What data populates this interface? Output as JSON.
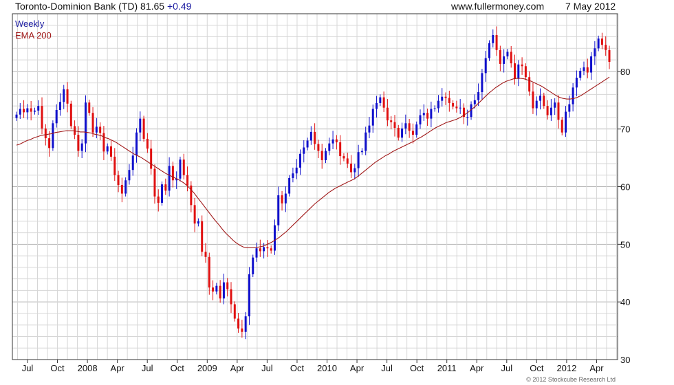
{
  "header": {
    "title": "Toronto-Dominion Bank (TD) 81.65",
    "change": "+0.49",
    "site": "www.fullermoney.com",
    "date": "7 May 2012"
  },
  "legend": {
    "weekly": "Weekly",
    "ema": "EMA 200"
  },
  "copyright": "© 2012 Stockcube Research Ltd",
  "colors": {
    "up": "#1010cc",
    "down": "#e01010",
    "ema": "#a01818",
    "grid": "#d6d6d6",
    "legend_weekly": "#1a1aa0",
    "legend_ema": "#a01818"
  },
  "chart_data": {
    "type": "candlestick",
    "ylim": [
      30,
      90
    ],
    "y_ticks": [
      "30",
      "40",
      "50",
      "60",
      "70",
      "80"
    ],
    "y_tick_values": [
      30,
      40,
      50,
      60,
      70,
      80
    ],
    "y_axis_side": "right",
    "x_ticks": [
      "Jul",
      "Oct",
      "2008",
      "Apr",
      "Jul",
      "Oct",
      "2009",
      "Apr",
      "Jul",
      "Oct",
      "2010",
      "Apr",
      "Jul",
      "Oct",
      "2011",
      "Apr",
      "Jul",
      "Oct",
      "2012",
      "Apr"
    ],
    "series": [
      {
        "name": "Weekly",
        "style": "candles",
        "values": [
          72.5,
          73.5,
          72.9,
          73.6,
          73.0,
          73.2,
          74.0,
          70.1,
          68.4,
          66.7,
          71.0,
          73.3,
          74.7,
          76.9,
          74.4,
          70.5,
          69.0,
          66.2,
          67.5,
          74.6,
          72.8,
          69.4,
          70.4,
          69.3,
          66.1,
          67.0,
          65.2,
          62.0,
          60.3,
          58.8,
          61.1,
          62.9,
          65.4,
          69.4,
          71.8,
          68.3,
          66.6,
          63.1,
          58.3,
          57.2,
          60.4,
          59.3,
          63.6,
          61.1,
          61.4,
          64.7,
          62.0,
          60.2,
          56.8,
          53.6,
          54.0,
          48.7,
          47.8,
          42.5,
          41.8,
          42.8,
          40.6,
          43.4,
          42.2,
          39.6,
          37.1,
          35.4,
          34.8,
          37.5,
          44.8,
          47.7,
          49.3,
          48.8,
          49.5,
          49.3,
          48.9,
          53.3,
          58.5,
          57.1,
          58.8,
          61.5,
          62.3,
          63.3,
          65.7,
          66.8,
          68.0,
          69.5,
          67.4,
          66.2,
          64.6,
          66.2,
          67.5,
          68.2,
          67.7,
          65.3,
          64.9,
          64.0,
          62.5,
          63.2,
          66.0,
          66.2,
          69.4,
          70.6,
          73.5,
          74.5,
          75.5,
          73.7,
          71.5,
          71.2,
          70.2,
          68.5,
          70.1,
          71.0,
          69.7,
          69.0,
          70.8,
          72.4,
          72.8,
          71.8,
          73.5,
          73.6,
          74.9,
          75.6,
          75.4,
          74.5,
          73.9,
          73.6,
          73.7,
          72.1,
          72.1,
          74.3,
          75.0,
          76.4,
          79.7,
          82.3,
          84.9,
          86.3,
          83.7,
          81.3,
          82.6,
          83.4,
          81.4,
          78.7,
          81.2,
          80.9,
          79.0,
          76.5,
          73.6,
          74.9,
          75.8,
          74.0,
          72.4,
          73.7,
          74.6,
          71.6,
          69.4,
          73.0,
          74.3,
          77.2,
          78.9,
          80.1,
          80.7,
          79.8,
          82.6,
          84.0,
          85.7,
          84.6,
          83.7,
          81.65
        ]
      },
      {
        "name": "EMA 200",
        "style": "line",
        "values": [
          67.2,
          67.4,
          67.7,
          68.0,
          68.2,
          68.5,
          68.7,
          68.9,
          69.0,
          69.1,
          69.2,
          69.4,
          69.5,
          69.6,
          69.7,
          69.7,
          69.7,
          69.6,
          69.5,
          69.5,
          69.4,
          69.3,
          69.1,
          69.0,
          68.8,
          68.5,
          68.3,
          68.0,
          67.7,
          67.3,
          66.9,
          66.5,
          66.1,
          65.7,
          65.4,
          65.1,
          64.7,
          64.3,
          63.9,
          63.5,
          63.1,
          62.7,
          62.3,
          62.0,
          61.7,
          61.4,
          61.1,
          60.7,
          60.2,
          59.6,
          58.9,
          58.1,
          57.3,
          56.5,
          55.7,
          54.9,
          54.1,
          53.4,
          52.6,
          51.9,
          51.3,
          50.7,
          50.2,
          49.8,
          49.5,
          49.4,
          49.4,
          49.4,
          49.5,
          49.6,
          49.8,
          50.1,
          50.4,
          50.8,
          51.2,
          51.7,
          52.2,
          52.8,
          53.4,
          54.0,
          54.6,
          55.2,
          55.8,
          56.4,
          57.0,
          57.5,
          58.0,
          58.5,
          59.0,
          59.4,
          59.8,
          60.1,
          60.4,
          60.7,
          61.0,
          61.3,
          61.7,
          62.2,
          62.7,
          63.2,
          63.7,
          64.2,
          64.6,
          65.0,
          65.4,
          65.7,
          66.1,
          66.4,
          66.7,
          67.0,
          67.3,
          67.6,
          67.9,
          68.3,
          68.6,
          69.0,
          69.4,
          69.8,
          70.2,
          70.5,
          70.8,
          71.1,
          71.3,
          71.5,
          71.7,
          72.0,
          72.4,
          72.8,
          73.3,
          73.8,
          74.4,
          75.0,
          75.6,
          76.2,
          76.7,
          77.2,
          77.6,
          78.0,
          78.3,
          78.5,
          78.7,
          78.8,
          78.8,
          78.7,
          78.5,
          78.3,
          78.0,
          77.7,
          77.4,
          77.0,
          76.6,
          76.2,
          75.8,
          75.5,
          75.3,
          75.2,
          75.2,
          75.3,
          75.5,
          75.8,
          76.2,
          76.6,
          77.0,
          77.4,
          77.8,
          78.2,
          78.6,
          79.0
        ]
      }
    ]
  }
}
